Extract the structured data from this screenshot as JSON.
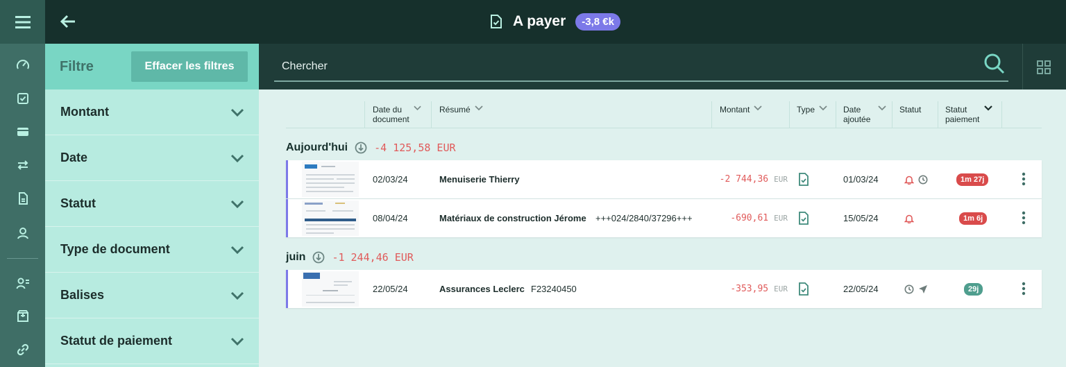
{
  "header": {
    "title": "A payer",
    "badge": "-3,8 €k",
    "back_icon": "arrow-left-icon",
    "title_icon": "document-check-icon"
  },
  "rail": {
    "menu_icon": "hamburger-icon",
    "items": [
      "dashboard-icon",
      "checklist-icon",
      "card-icon",
      "transfer-icon",
      "document-icon",
      "contacts-icon",
      "person-list-icon",
      "archive-icon",
      "link-icon"
    ]
  },
  "filter": {
    "title": "Filtre",
    "clear_label": "Effacer les filtres",
    "sections": [
      "Montant",
      "Date",
      "Statut",
      "Type de document",
      "Balises",
      "Statut de paiement"
    ]
  },
  "search": {
    "placeholder": "Chercher"
  },
  "table": {
    "columns": {
      "date_doc": "Date du document",
      "resume": "Résumé",
      "montant": "Montant",
      "type": "Type",
      "date_added": "Date ajoutée",
      "statut": "Statut",
      "statut_paiement": "Statut paiement"
    },
    "groups": [
      {
        "label": "Aujourd'hui",
        "amount": "-4 125,58 EUR",
        "rows": [
          {
            "date": "02/03/24",
            "title": "Menuiserie Thierry",
            "ref": "",
            "amount": "-2 744,36",
            "currency": "EUR",
            "added": "01/03/24",
            "pay_status": "1m 27j"
          },
          {
            "date": "08/04/24",
            "title": "Matériaux de construction Jérome",
            "ref": "+++024/2840/37296+++",
            "amount": "-690,61",
            "currency": "EUR",
            "added": "15/05/24",
            "pay_status": "1m 6j"
          }
        ]
      },
      {
        "label": "juin",
        "amount": "-1 244,46 EUR",
        "rows": [
          {
            "date": "22/05/24",
            "title": "Assurances Leclerc",
            "ref": "F23240450",
            "amount": "-353,95",
            "currency": "EUR",
            "added": "22/05/24",
            "pay_status": "29j"
          }
        ]
      }
    ]
  },
  "colors": {
    "accent": "#7c79e8",
    "negative": "#e05a5a",
    "topbar": "#16302c",
    "filter_bg": "#b7ebe0"
  }
}
